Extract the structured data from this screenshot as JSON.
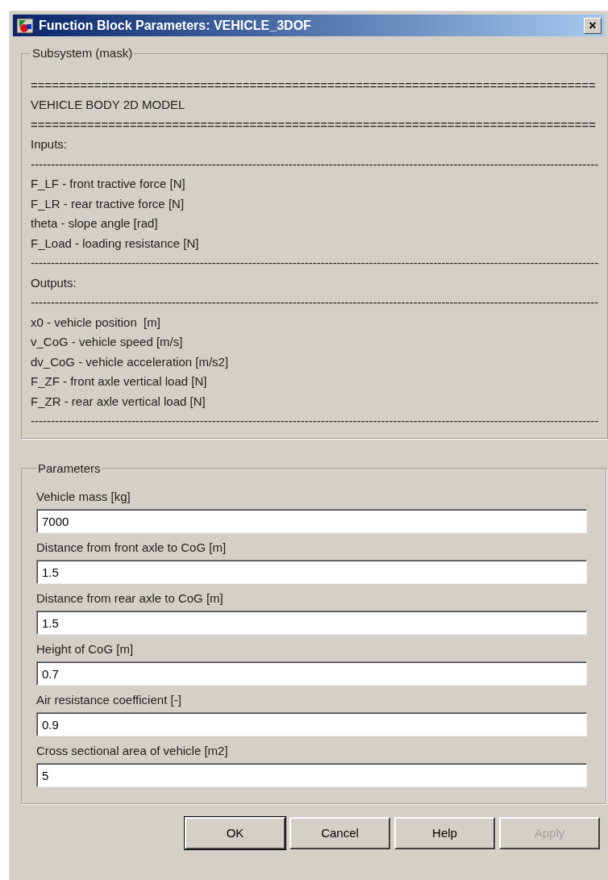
{
  "window": {
    "title": "Function Block Parameters: VEHICLE_3DOF",
    "close": "×"
  },
  "mask": {
    "label": "Subsystem (mask)",
    "lines": [
      "================================================================================",
      "VEHICLE BODY 2D MODEL",
      "================================================================================",
      "Inputs:",
      "---------------------------------------------------------------------------------------------------------------------------------------------",
      "F_LF - front tractive force [N]",
      "F_LR - rear tractive force [N]",
      "theta - slope angle [rad]",
      "F_Load - loading resistance [N]",
      "---------------------------------------------------------------------------------------------------------------------------------------------",
      "Outputs:",
      "---------------------------------------------------------------------------------------------------------------------------------------------",
      "x0 - vehicle position  [m]",
      "v_CoG - vehicle speed [m/s]",
      "dv_CoG - vehicle acceleration [m/s2]",
      "F_ZF - front axle vertical load [N]",
      "F_ZR - rear axle vertical load [N]",
      "---------------------------------------------------------------------------------------------------------------------------------------------"
    ]
  },
  "parameters": {
    "label": "Parameters",
    "fields": [
      {
        "label": "Vehicle mass [kg]",
        "value": "7000"
      },
      {
        "label": "Distance from front axle to CoG [m]",
        "value": "1.5"
      },
      {
        "label": "Distance from rear axle to CoG [m]",
        "value": "1.5"
      },
      {
        "label": "Height of CoG [m]",
        "value": "0.7"
      },
      {
        "label": "Air resistance coefficient [-]",
        "value": "0.9"
      },
      {
        "label": "Cross sectional area of vehicle [m2]",
        "value": "5"
      }
    ]
  },
  "buttons": [
    {
      "label": "OK",
      "disabled": false
    },
    {
      "label": "Cancel",
      "disabled": false
    },
    {
      "label": "Help",
      "disabled": false
    },
    {
      "label": "Apply",
      "disabled": true
    }
  ]
}
